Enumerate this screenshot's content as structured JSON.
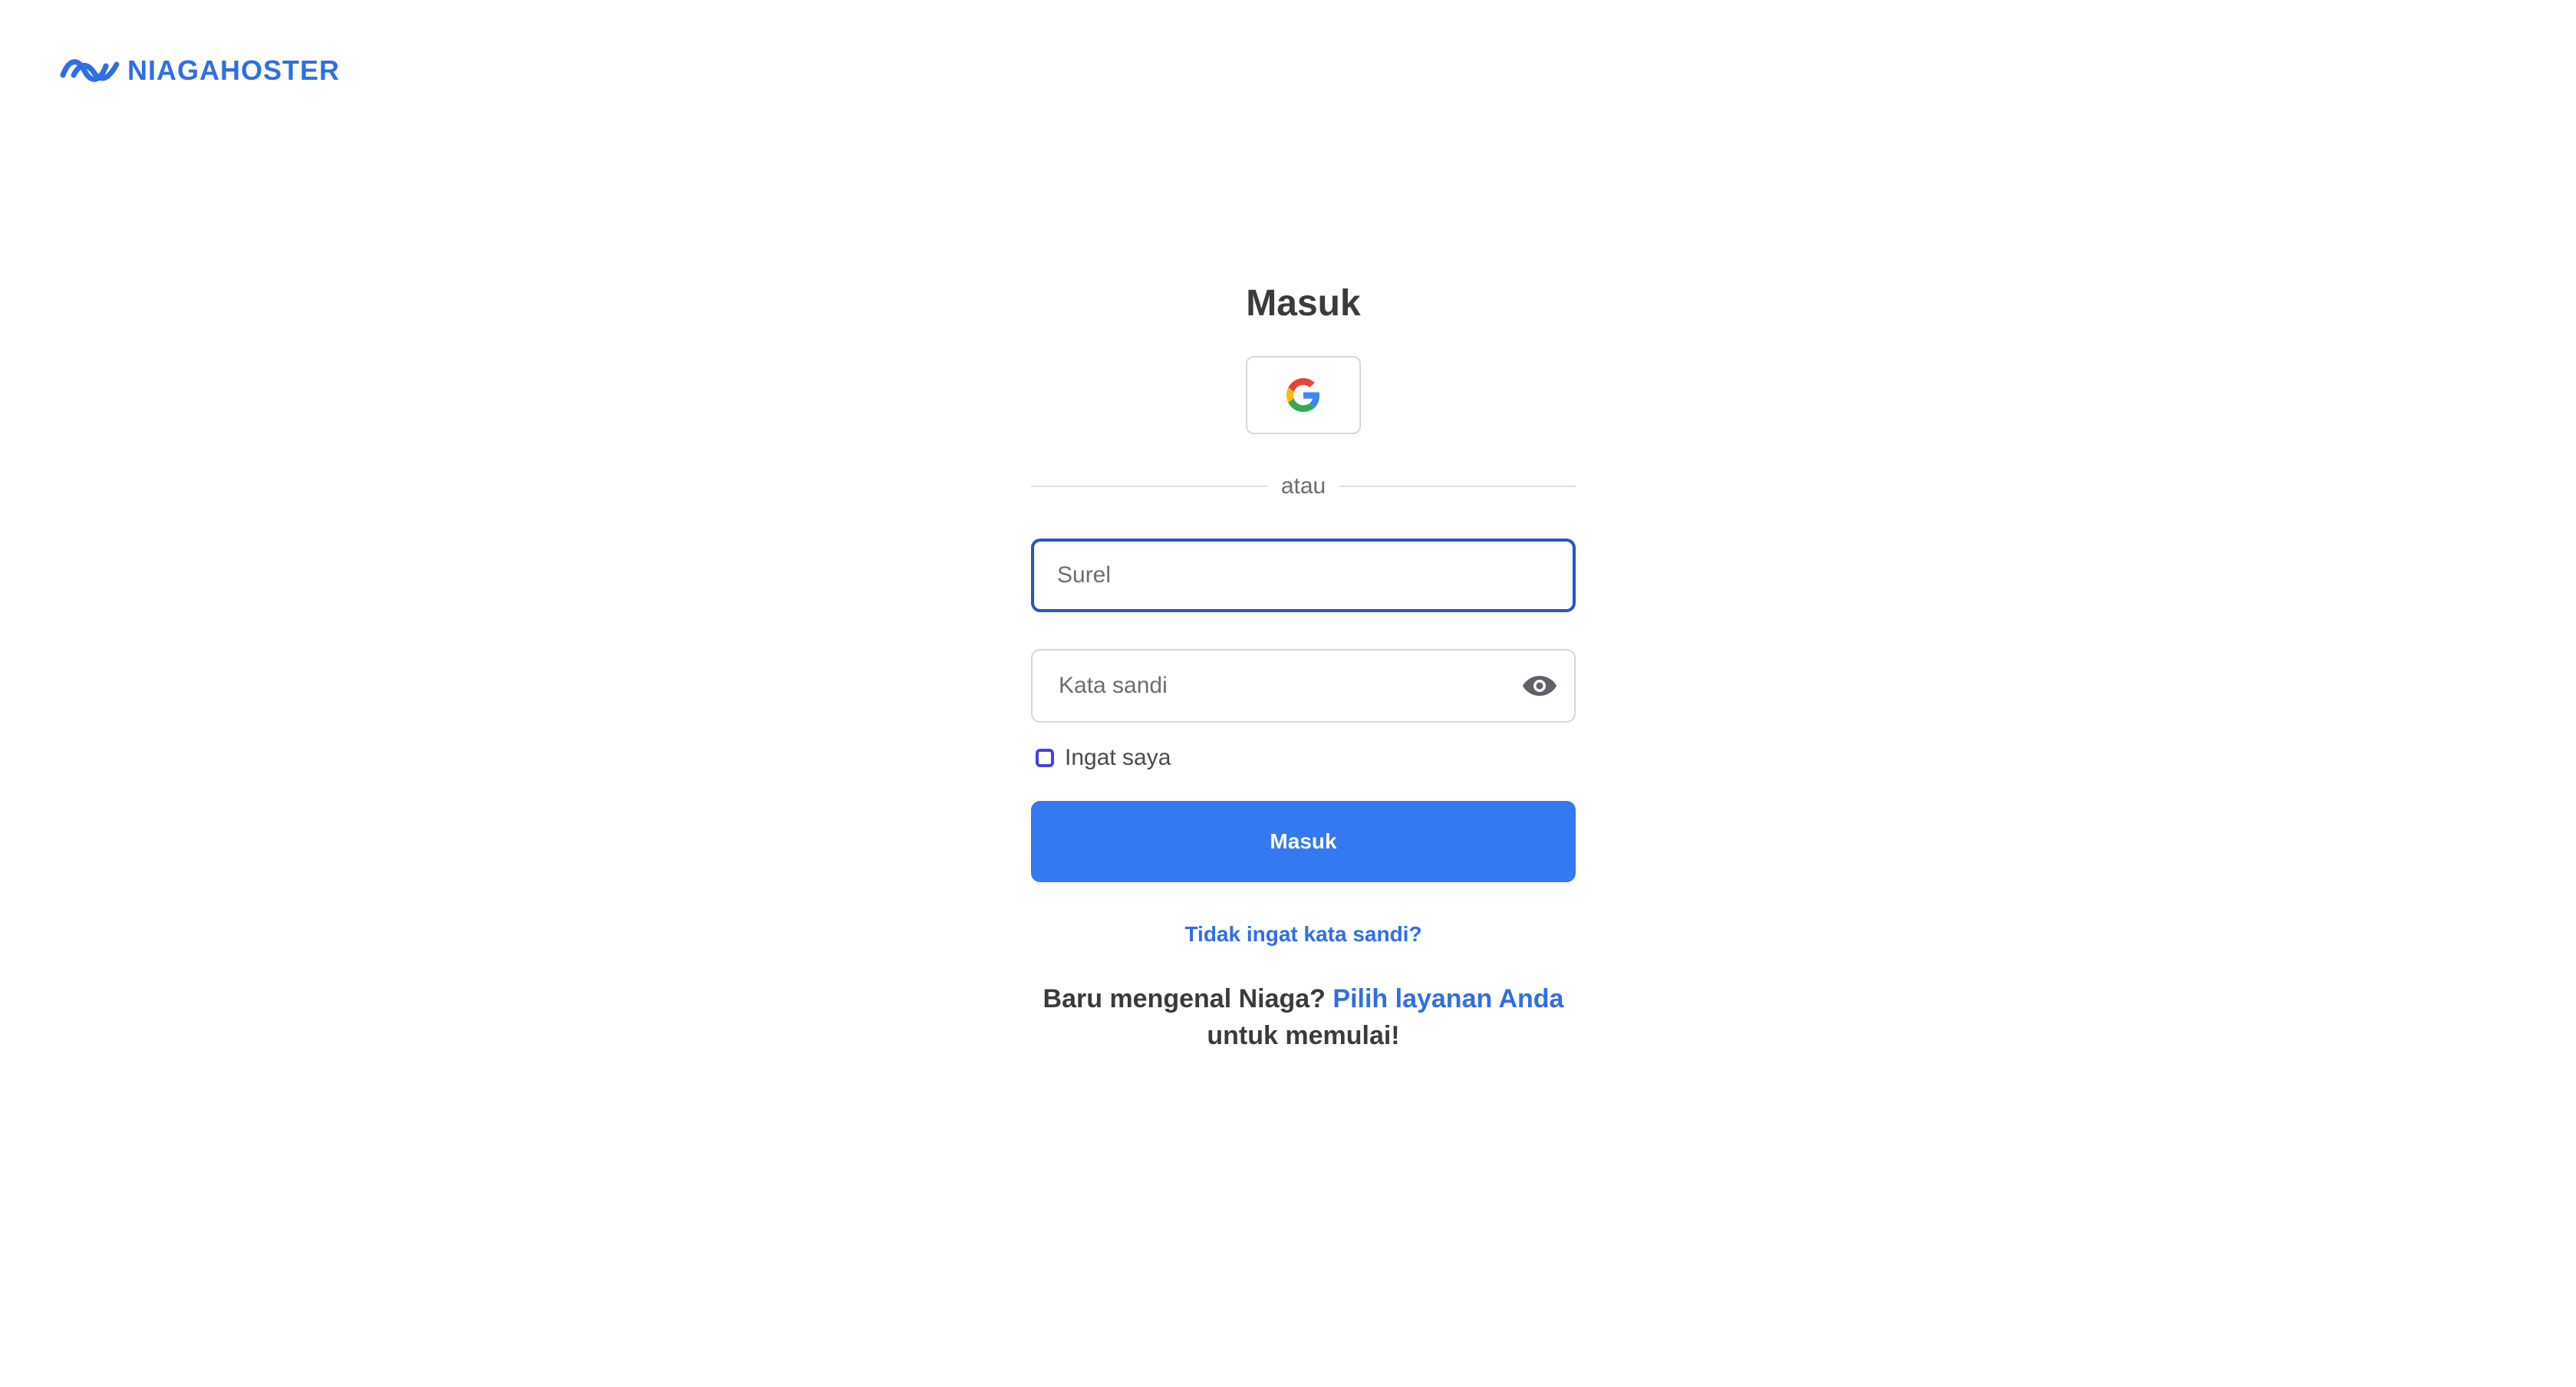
{
  "brand": {
    "name": "NIAGAHOSTER",
    "color": "#2f6fe4",
    "logo_icon": "niagahoster-wave-icon"
  },
  "login": {
    "title": "Masuk",
    "google_button_icon": "google-g-icon",
    "divider_text": "atau",
    "email": {
      "value": "",
      "placeholder": "Surel"
    },
    "password": {
      "value": "",
      "placeholder": "Kata sandi",
      "toggle_icon": "eye-icon"
    },
    "remember_me": {
      "label": "Ingat saya",
      "checked": false
    },
    "submit_label": "Masuk",
    "submit_color": "#3478f2",
    "forgot_link": "Tidak ingat kata sandi?",
    "signup": {
      "prefix": "Baru mengenal Niaga?",
      "link": "Pilih layanan Anda",
      "suffix": "untuk memulai!"
    }
  }
}
